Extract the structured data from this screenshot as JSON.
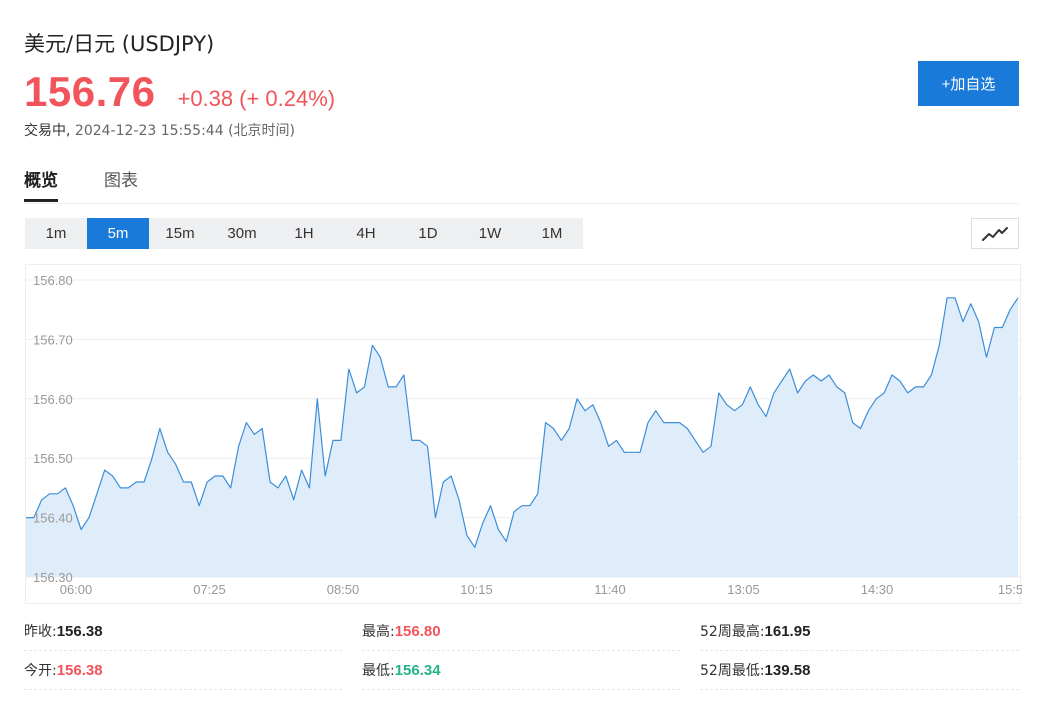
{
  "header": {
    "title": "美元/日元 (USDJPY)",
    "price": "156.76",
    "change": "+0.38",
    "change_pct": "(+ 0.24%)",
    "status": "交易中,",
    "timestamp": "2024-12-23 15:55:44",
    "timezone": "(北京时间)",
    "add_button": "+加自选"
  },
  "tabs": [
    {
      "label": "概览",
      "active": true
    },
    {
      "label": "图表",
      "active": false
    }
  ],
  "periods": [
    {
      "label": "1m",
      "active": false
    },
    {
      "label": "5m",
      "active": true
    },
    {
      "label": "15m",
      "active": false
    },
    {
      "label": "30m",
      "active": false
    },
    {
      "label": "1H",
      "active": false
    },
    {
      "label": "4H",
      "active": false
    },
    {
      "label": "1D",
      "active": false
    },
    {
      "label": "1W",
      "active": false
    },
    {
      "label": "1M",
      "active": false
    }
  ],
  "chart_type_icon": "line-chart-icon",
  "colors": {
    "up": "#f2545b",
    "down": "#24b38a",
    "accent": "#1a7ad9",
    "line": "#3d8ed8",
    "fill": "#dcebfb"
  },
  "stats": {
    "prev_close_label": "昨收:",
    "prev_close": "156.38",
    "high_label": "最高:",
    "high": "156.80",
    "w52_high_label": "52周最高:",
    "w52_high": "161.95",
    "open_label": "今开:",
    "open": "156.38",
    "low_label": "最低:",
    "low": "156.34",
    "w52_low_label": "52周最低:",
    "w52_low": "139.58"
  },
  "chart_data": {
    "type": "area",
    "ylim": [
      156.3,
      156.8
    ],
    "yticks": [
      "156.80",
      "156.70",
      "156.60",
      "156.50",
      "156.40",
      "156.30"
    ],
    "xtick_labels": [
      "06:00",
      "07:25",
      "08:50",
      "10:15",
      "11:40",
      "13:05",
      "14:30",
      "15:5"
    ],
    "grid": true,
    "series": [
      {
        "values": [
          156.4,
          156.4,
          156.43,
          156.44,
          156.44,
          156.45,
          156.42,
          156.38,
          156.4,
          156.44,
          156.48,
          156.47,
          156.45,
          156.45,
          156.46,
          156.46,
          156.5,
          156.55,
          156.51,
          156.49,
          156.46,
          156.46,
          156.42,
          156.46,
          156.47,
          156.47,
          156.45,
          156.52,
          156.56,
          156.54,
          156.55,
          156.46,
          156.45,
          156.47,
          156.43,
          156.48,
          156.45,
          156.6,
          156.47,
          156.53,
          156.53,
          156.65,
          156.61,
          156.62,
          156.69,
          156.67,
          156.62,
          156.62,
          156.64,
          156.53,
          156.53,
          156.52,
          156.4,
          156.46,
          156.47,
          156.43,
          156.37,
          156.35,
          156.39,
          156.42,
          156.38,
          156.36,
          156.41,
          156.42,
          156.42,
          156.44,
          156.56,
          156.55,
          156.53,
          156.55,
          156.6,
          156.58,
          156.59,
          156.56,
          156.52,
          156.53,
          156.51,
          156.51,
          156.51,
          156.56,
          156.58,
          156.56,
          156.56,
          156.56,
          156.55,
          156.53,
          156.51,
          156.52,
          156.61,
          156.59,
          156.58,
          156.59,
          156.62,
          156.59,
          156.57,
          156.61,
          156.63,
          156.65,
          156.61,
          156.63,
          156.64,
          156.63,
          156.64,
          156.62,
          156.61,
          156.56,
          156.55,
          156.58,
          156.6,
          156.61,
          156.64,
          156.63,
          156.61,
          156.62,
          156.62,
          156.64,
          156.69,
          156.77,
          156.77,
          156.73,
          156.76,
          156.73,
          156.67,
          156.72,
          156.72,
          156.75,
          156.77
        ]
      }
    ]
  }
}
